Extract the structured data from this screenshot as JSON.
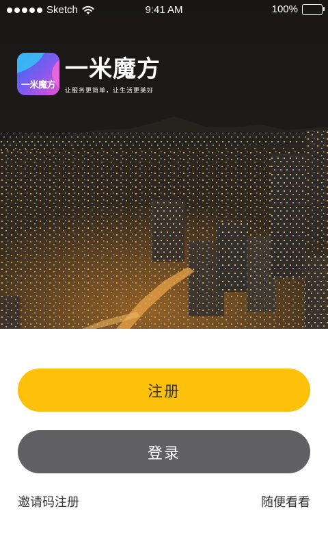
{
  "status_bar": {
    "carrier": "Sketch",
    "time": "9:41 AM",
    "battery_percent": "100%",
    "battery_level": 1.0,
    "signal_icon": "signal-dots-icon",
    "wifi_icon": "wifi-icon",
    "battery_icon": "battery-icon"
  },
  "brand": {
    "icon_label": "一米魔方",
    "name": "一米魔方",
    "slogan": "让服务更简单，让生活更美好"
  },
  "hero": {
    "description_icon": "city-night-photo"
  },
  "actions": {
    "register_label": "注册",
    "login_label": "登录",
    "invite_register_label": "邀请码注册",
    "browse_label": "随便看看"
  },
  "colors": {
    "accent_yellow": "#fdc10b",
    "login_gray": "#606062",
    "text_dark": "#333333",
    "icon_blue": "#3b6ff5",
    "icon_pink": "#e85ad2"
  }
}
